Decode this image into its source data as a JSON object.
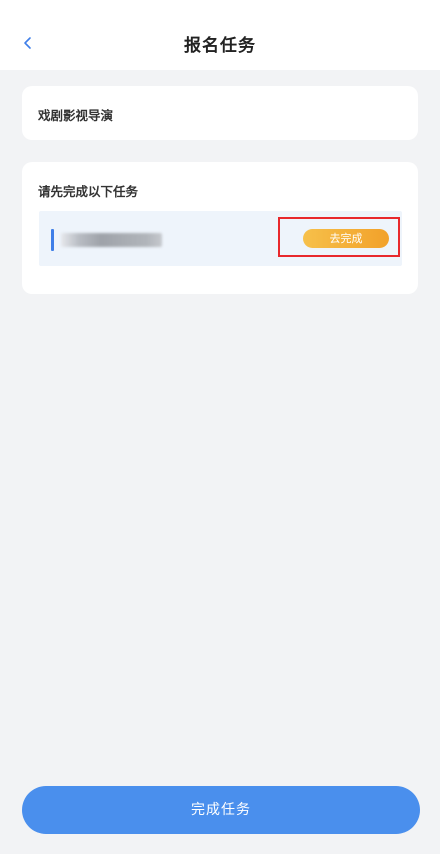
{
  "header": {
    "title": "报名任务",
    "back_icon": "chevron-left-icon"
  },
  "activity": {
    "name": "戏剧影视导演"
  },
  "tasks": {
    "heading": "请先完成以下任务",
    "items": [
      {
        "name": "",
        "action_label": "去完成"
      }
    ]
  },
  "footer": {
    "complete_label": "完成任务"
  },
  "colors": {
    "primary": "#4a8fed",
    "accent_bar": "#3f7fe8",
    "action_gradient_start": "#f6c04a",
    "action_gradient_end": "#f2a12a",
    "highlight_border": "#e8282c",
    "background": "#f2f3f5"
  }
}
